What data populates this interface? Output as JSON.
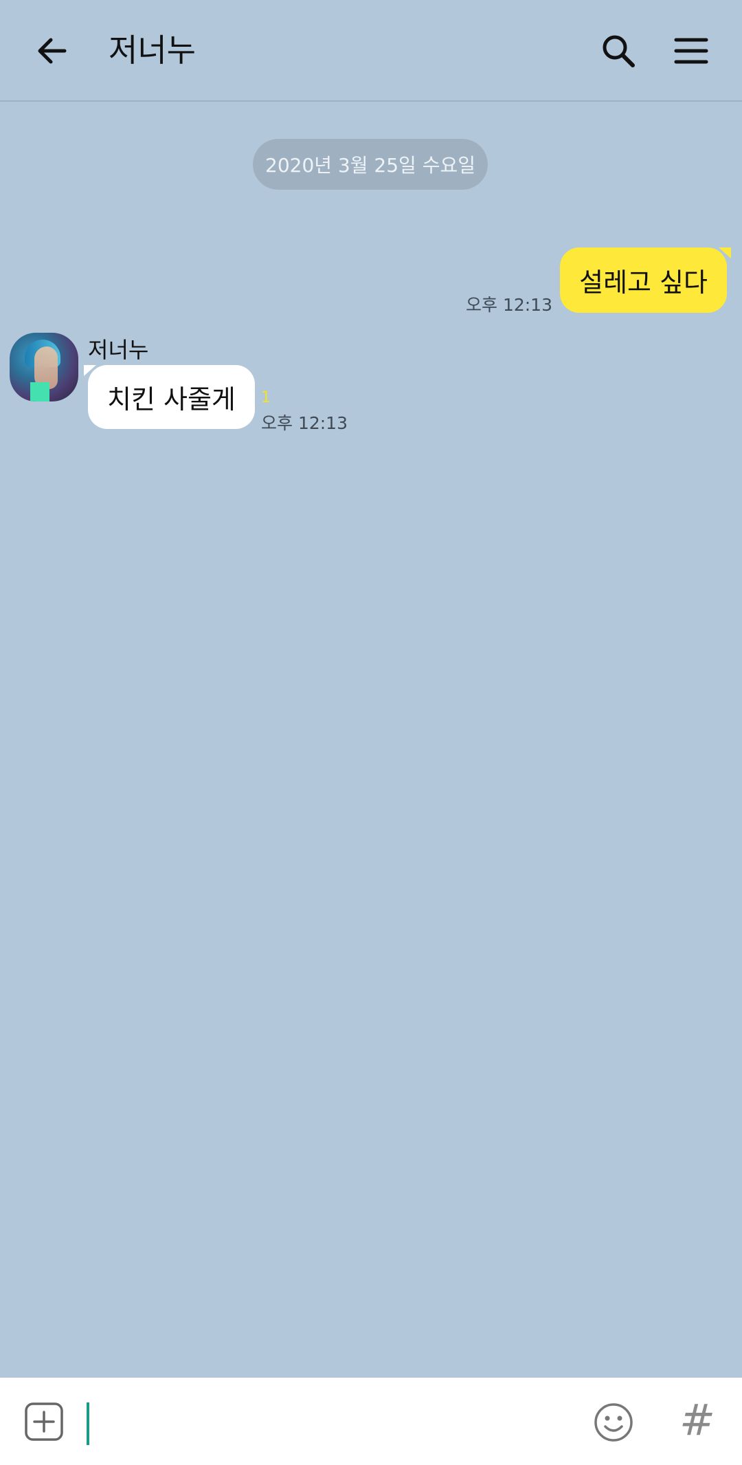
{
  "header": {
    "title": "저너누",
    "back_icon": "arrow-left-icon",
    "search_icon": "search-icon",
    "menu_icon": "menu-icon"
  },
  "date_divider": "2020년 3월 25일 수요일",
  "messages": [
    {
      "direction": "outgoing",
      "text": "설레고 싶다",
      "time": "오후 12:13"
    },
    {
      "direction": "incoming",
      "sender": "저너누",
      "text": "치킨 사줄게",
      "unread": "1",
      "time": "오후 12:13"
    }
  ],
  "composer": {
    "attach_icon": "plus-box-icon",
    "emoji_icon": "emoji-icon",
    "hash_label": "#"
  },
  "colors": {
    "background": "#b2c7da",
    "outgoing_bubble": "#fee83a",
    "incoming_bubble": "#ffffff",
    "unread": "#f6e02a",
    "cursor": "#1a9a87"
  }
}
